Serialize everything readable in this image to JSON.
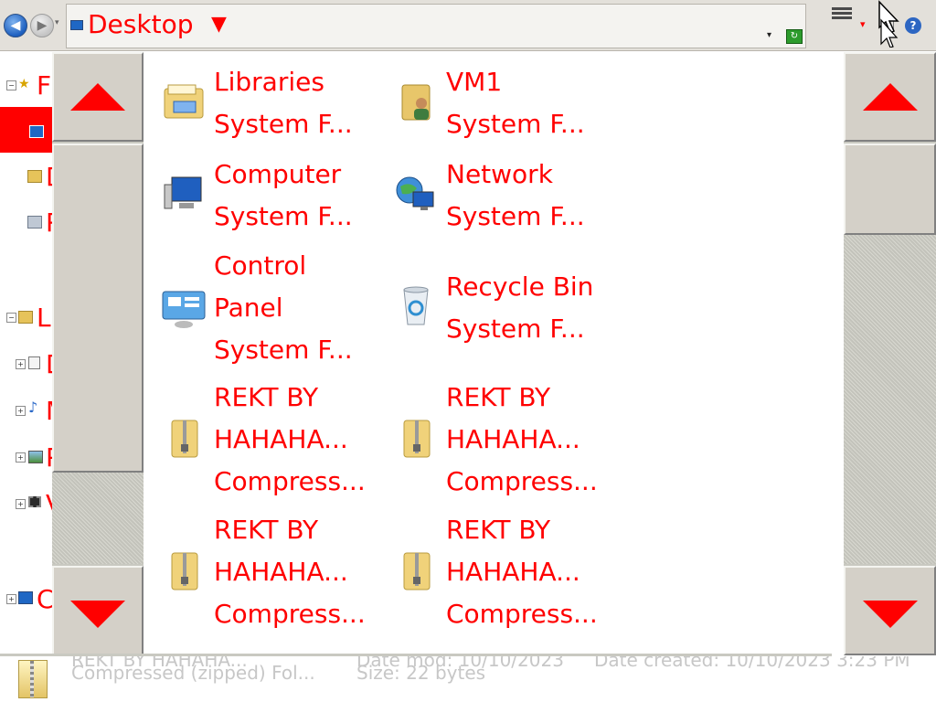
{
  "toolbar": {
    "address": "Desktop",
    "back_glyph": "◀",
    "forward_glyph": "▶",
    "help_glyph": "?"
  },
  "nav_pane": {
    "items": [
      {
        "label": "F",
        "expander": "−",
        "icon": "favorites-star-icon"
      },
      {
        "label": "",
        "icon": "desktop-icon",
        "selected": true
      },
      {
        "label": "D",
        "icon": "downloads-icon"
      },
      {
        "label": "R",
        "icon": "recent-places-icon"
      },
      {
        "label": "L",
        "expander": "−",
        "icon": "libraries-icon"
      },
      {
        "label": "D",
        "expander": "+",
        "icon": "documents-icon"
      },
      {
        "label": "M",
        "expander": "+",
        "icon": "music-icon"
      },
      {
        "label": "P",
        "expander": "+",
        "icon": "pictures-icon"
      },
      {
        "label": "V",
        "expander": "+",
        "icon": "videos-icon"
      },
      {
        "label": "C",
        "expander": "+",
        "icon": "computer-icon"
      }
    ]
  },
  "files": [
    {
      "lines": [
        "Libraries",
        "System F..."
      ],
      "icon": "libraries-folder-icon"
    },
    {
      "lines": [
        "VM1",
        "System F..."
      ],
      "icon": "user-folder-icon"
    },
    {
      "lines": [
        "Computer",
        "System F..."
      ],
      "icon": "computer-icon"
    },
    {
      "lines": [
        "Network",
        "System F..."
      ],
      "icon": "network-icon"
    },
    {
      "lines": [
        "Control",
        "Panel",
        "System F..."
      ],
      "icon": "control-panel-icon"
    },
    {
      "lines": [
        "Recycle Bin",
        "System F..."
      ],
      "icon": "recycle-bin-icon"
    },
    {
      "lines": [
        "REKT BY",
        "HAHAHA...",
        "Compress..."
      ],
      "icon": "zip-folder-icon"
    },
    {
      "lines": [
        "REKT BY",
        "HAHAHA...",
        "Compress..."
      ],
      "icon": "zip-folder-icon"
    },
    {
      "lines": [
        "REKT BY",
        "HAHAHA...",
        "Compress..."
      ],
      "icon": "zip-folder-icon"
    },
    {
      "lines": [
        "REKT BY",
        "HAHAHA...",
        "Compress..."
      ],
      "icon": "zip-folder-icon"
    }
  ],
  "status": {
    "line1_left": "REKT BY HAHAHA...",
    "line1_mid": "Date mod: 10/10/2023",
    "line1_right": "Date created: 10/10/2023 3:23 PM",
    "line2_left": "Compressed (zipped) Fol...",
    "line2_right": "Size: 22 bytes"
  },
  "colors": {
    "accent": "#ff0000",
    "chrome": "#d4d0c8"
  }
}
